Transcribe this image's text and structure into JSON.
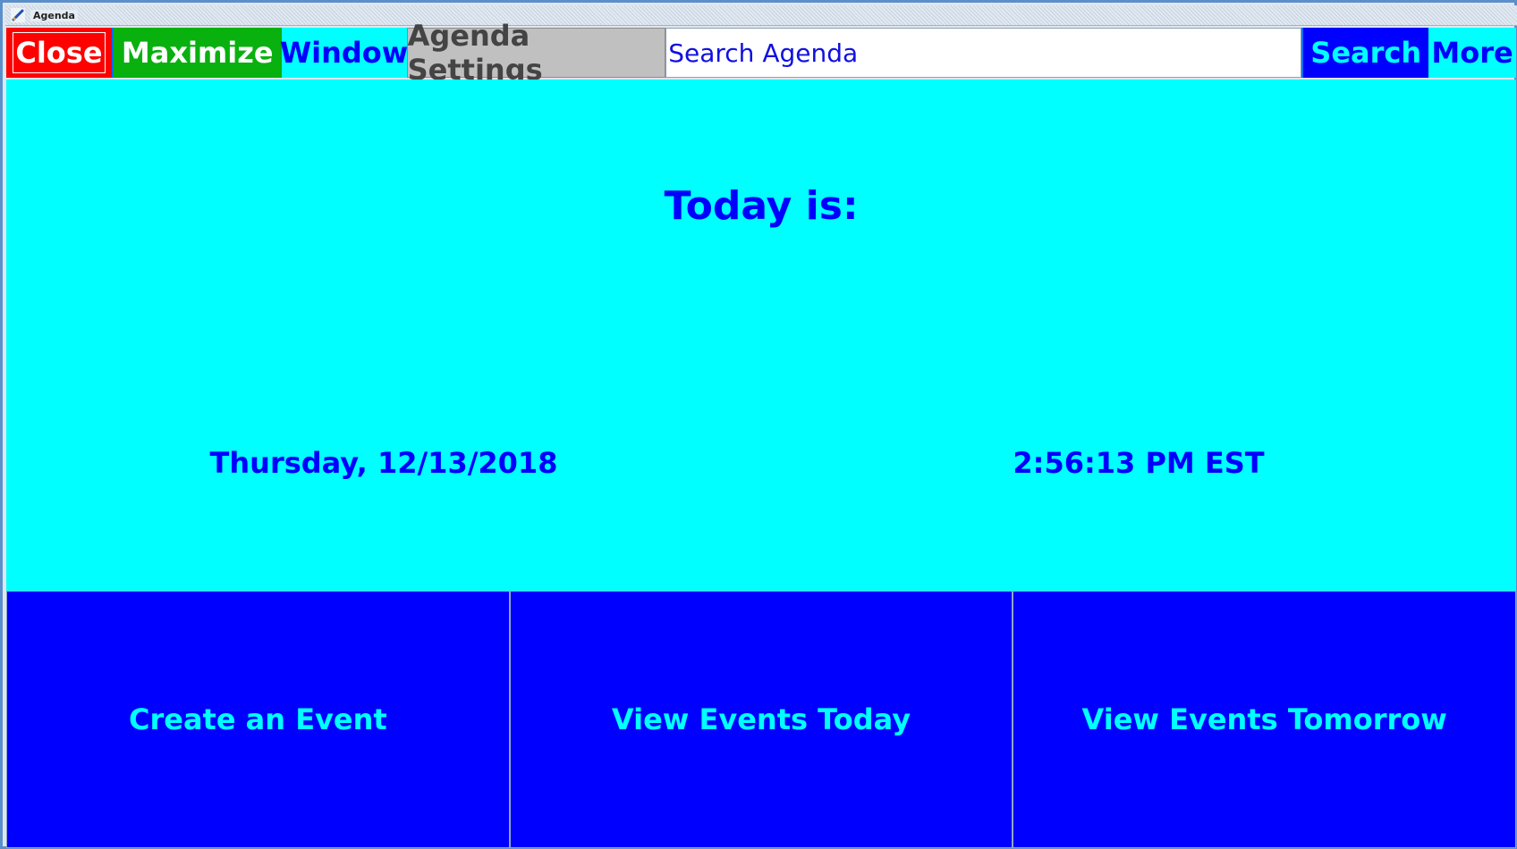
{
  "window": {
    "title": "Agenda"
  },
  "toolbar": {
    "close_label": "Close",
    "maximize_label": "Maximize",
    "window_label": "Window",
    "settings_label": "Agenda Settings",
    "search_value": "Search Agenda",
    "search_button_label": "Search",
    "more_label": "More"
  },
  "main": {
    "heading": "Today is:",
    "date": "Thursday, 12/13/2018",
    "time": "2:56:13 PM EST"
  },
  "actions": {
    "create": "Create an Event",
    "today": "View Events Today",
    "tomorrow": "View Events Tomorrow"
  },
  "colors": {
    "close": "#ff0000",
    "maximize": "#08b10e",
    "cyan": "#00ffff",
    "blue": "#0000ff",
    "settings_gray": "#c0c0c0"
  },
  "icons": {
    "title": "pencil-icon"
  }
}
